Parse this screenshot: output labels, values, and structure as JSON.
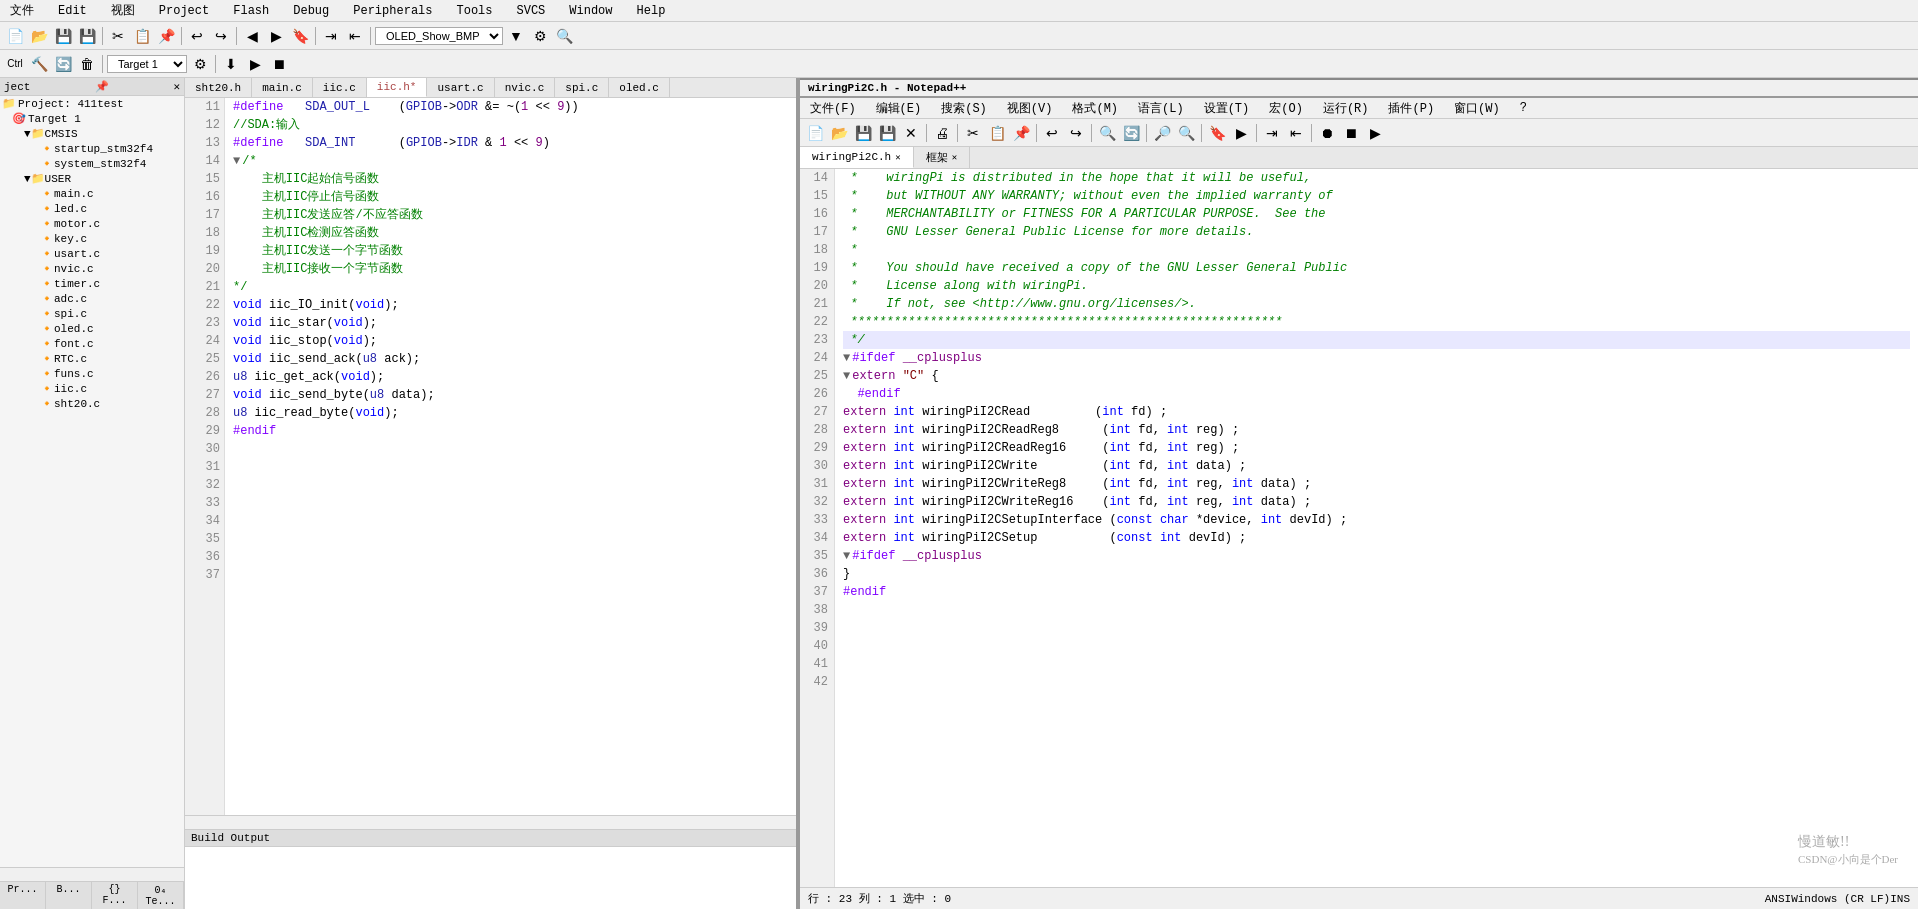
{
  "keil": {
    "menu": {
      "items": [
        "文件",
        "Edit",
        "视图",
        "Project",
        "Flash",
        "Debug",
        "Peripherals",
        "Tools",
        "SVCS",
        "Window",
        "Help"
      ]
    },
    "tabs": [
      {
        "label": "sht20.h",
        "active": false,
        "modified": false
      },
      {
        "label": "main.c",
        "active": false,
        "modified": false
      },
      {
        "label": "iic.c",
        "active": false,
        "modified": false
      },
      {
        "label": "iic.h*",
        "active": true,
        "modified": true
      },
      {
        "label": "usart.c",
        "active": false,
        "modified": false
      },
      {
        "label": "nvic.c",
        "active": false,
        "modified": false
      },
      {
        "label": "spi.c",
        "active": false,
        "modified": false
      },
      {
        "label": "oled.c",
        "active": false,
        "modified": false
      }
    ],
    "code_lines": [
      {
        "num": 11,
        "content": "#define   SDA_OUT_L    (GPIOB->ODR &= ~(1 << 9))"
      },
      {
        "num": 12,
        "content": "//SDA:输入"
      },
      {
        "num": 13,
        "content": "#define   SDA_INT      (GPIOB->IDR & 1 << 9)"
      },
      {
        "num": 14,
        "content": ""
      },
      {
        "num": 15,
        "content": ""
      },
      {
        "num": 16,
        "content": "/*"
      },
      {
        "num": 17,
        "content": "    主机IIC起始信号函数"
      },
      {
        "num": 18,
        "content": "    主机IIC停止信号函数"
      },
      {
        "num": 19,
        "content": "    主机IIC发送应答/不应答函数"
      },
      {
        "num": 20,
        "content": "    主机IIC检测应答函数"
      },
      {
        "num": 21,
        "content": "    主机IIC发送一个字节函数"
      },
      {
        "num": 22,
        "content": "    主机IIC接收一个字节函数"
      },
      {
        "num": 23,
        "content": "*/"
      },
      {
        "num": 24,
        "content": ""
      },
      {
        "num": 25,
        "content": "void iic_IO_init(void);"
      },
      {
        "num": 26,
        "content": "void iic_star(void);"
      },
      {
        "num": 27,
        "content": "void iic_stop(void);"
      },
      {
        "num": 28,
        "content": "void iic_send_ack(u8 ack);"
      },
      {
        "num": 29,
        "content": "u8 iic_get_ack(void);"
      },
      {
        "num": 30,
        "content": "void iic_send_byte(u8 data);"
      },
      {
        "num": 31,
        "content": "u8 iic_read_byte(void);"
      },
      {
        "num": 32,
        "content": ""
      },
      {
        "num": 33,
        "content": ""
      },
      {
        "num": 34,
        "content": "#endif"
      },
      {
        "num": 35,
        "content": ""
      },
      {
        "num": 36,
        "content": ""
      },
      {
        "num": 37,
        "content": ""
      }
    ],
    "project": {
      "name": "Project: 411test",
      "target": "Target 1",
      "groups": [
        {
          "name": "CMSIS",
          "expanded": true,
          "files": [
            "startup_stm32f4",
            "system_stm32f4"
          ]
        },
        {
          "name": "USER",
          "expanded": true,
          "files": [
            "main.c",
            "led.c",
            "motor.c",
            "key.c",
            "usart.c",
            "nvic.c",
            "timer.c",
            "adc.c",
            "spi.c",
            "oled.c",
            "font.c",
            "RTC.c",
            "funs.c",
            "iic.c",
            "sht20.c"
          ]
        }
      ]
    }
  },
  "notepad": {
    "title": "wiringPi2C.h - Notepad++",
    "menu": {
      "items": [
        "文件(F)",
        "编辑(E)",
        "搜索(S)",
        "视图(V)",
        "格式(M)",
        "语言(L)",
        "设置(T)",
        "宏(O)",
        "运行(R)",
        "插件(P)",
        "窗口(W)",
        "?"
      ]
    },
    "tabs": [
      {
        "label": "wiringPi2C.h",
        "active": true
      },
      {
        "label": "框架",
        "active": false
      }
    ],
    "code_lines": [
      {
        "num": 14,
        "content": " *    wiringPi is distributed in the hope that it will be useful,",
        "highlight": false
      },
      {
        "num": 15,
        "content": " *    but WITHOUT ANY WARRANTY; without even the implied warranty of",
        "highlight": false
      },
      {
        "num": 16,
        "content": " *    MERCHANTABILITY or FITNESS FOR A PARTICULAR PURPOSE.  See the",
        "highlight": false
      },
      {
        "num": 17,
        "content": " *    GNU Lesser General Public License for more details.",
        "highlight": false
      },
      {
        "num": 18,
        "content": " *",
        "highlight": false
      },
      {
        "num": 19,
        "content": " *    You should have received a copy of the GNU Lesser General Public",
        "highlight": false
      },
      {
        "num": 20,
        "content": " *    License along with wiringPi.",
        "highlight": false
      },
      {
        "num": 21,
        "content": " *    If not, see <http://www.gnu.org/licenses/>.",
        "highlight": false
      },
      {
        "num": 22,
        "content": " ************************************************************",
        "highlight": false
      },
      {
        "num": 23,
        "content": " */",
        "highlight": true
      },
      {
        "num": 24,
        "content": "",
        "highlight": false
      },
      {
        "num": 25,
        "content": "#ifdef __cplusplus",
        "highlight": false
      },
      {
        "num": 26,
        "content": "extern \"C\" {",
        "highlight": false
      },
      {
        "num": 27,
        "content": "  #endif",
        "highlight": false
      },
      {
        "num": 28,
        "content": "",
        "highlight": false
      },
      {
        "num": 29,
        "content": "extern int wiringPiI2CRead         (int fd) ;",
        "highlight": false
      },
      {
        "num": 30,
        "content": "extern int wiringPiI2CReadReg8      (int fd, int reg) ;",
        "highlight": false
      },
      {
        "num": 31,
        "content": "extern int wiringPiI2CReadReg16     (int fd, int reg) ;",
        "highlight": false
      },
      {
        "num": 32,
        "content": "",
        "highlight": false
      },
      {
        "num": 33,
        "content": "extern int wiringPiI2CWrite         (int fd, int data) ;",
        "highlight": false
      },
      {
        "num": 34,
        "content": "extern int wiringPiI2CWriteReg8     (int fd, int reg, int data) ;",
        "highlight": false
      },
      {
        "num": 35,
        "content": "extern int wiringPiI2CWriteReg16    (int fd, int reg, int data) ;",
        "highlight": false
      },
      {
        "num": 36,
        "content": "",
        "highlight": false
      },
      {
        "num": 37,
        "content": "extern int wiringPiI2CSetupInterface (const char *device, int devId) ;",
        "highlight": false
      },
      {
        "num": 38,
        "content": "extern int wiringPiI2CSetup          (const int devId) ;",
        "highlight": false
      },
      {
        "num": 39,
        "content": "",
        "highlight": false
      },
      {
        "num": 40,
        "content": "#ifdef __cplusplus",
        "highlight": false
      },
      {
        "num": 41,
        "content": "}",
        "highlight": false
      },
      {
        "num": 42,
        "content": "#endif",
        "highlight": false
      }
    ]
  },
  "status": {
    "build_output": "Build Output"
  }
}
